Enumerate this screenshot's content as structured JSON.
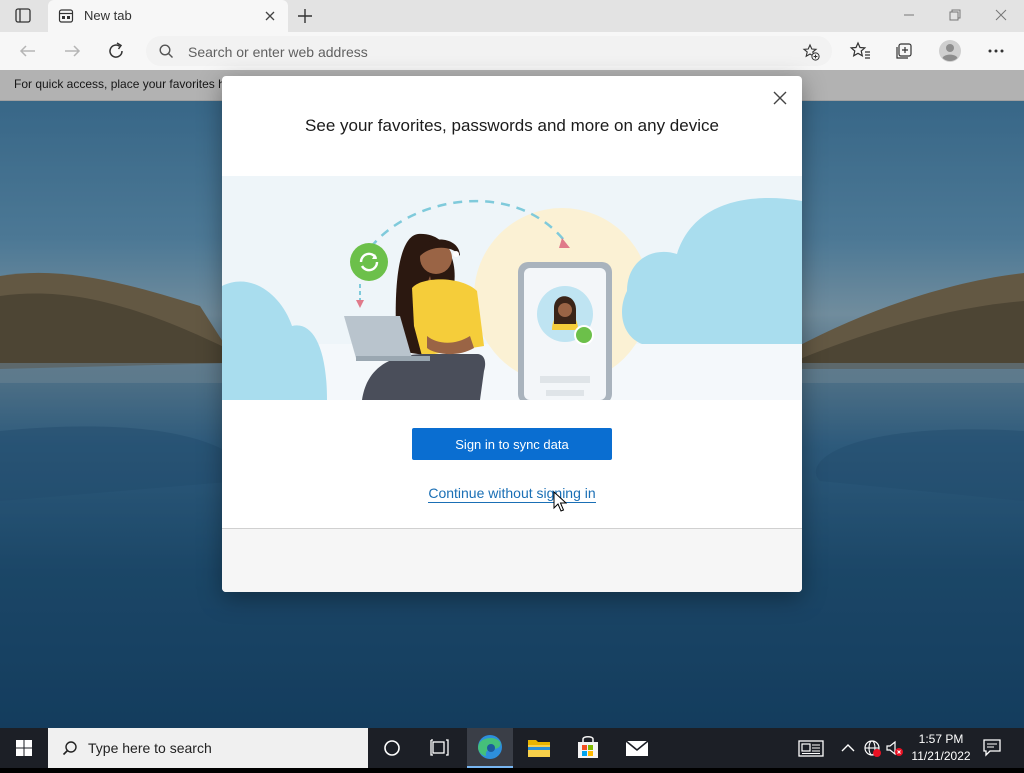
{
  "browser": {
    "tab": {
      "title": "New tab"
    },
    "address_bar": {
      "placeholder": "Search or enter web address"
    },
    "favorites_bar": {
      "message": "For quick access, place your favorites h"
    }
  },
  "dialog": {
    "title": "See your favorites, passwords and more on any device",
    "primary_button": "Sign in to sync data",
    "secondary_link": "Continue without signing in"
  },
  "taskbar": {
    "search_placeholder": "Type here to search",
    "time": "1:57 PM",
    "date": "11/21/2022"
  },
  "colors": {
    "accent": "#0a6ed1",
    "link": "#1a6fb5",
    "taskbar": "#1c1f26"
  },
  "icons": [
    "tab-actions-icon",
    "newtab-page-icon",
    "close-icon",
    "plus-icon",
    "minimize-icon",
    "restore-icon",
    "back-icon",
    "forward-icon",
    "refresh-icon",
    "search-icon",
    "favorite-add-icon",
    "favorites-icon",
    "collections-icon",
    "profile-icon",
    "more-icon",
    "windows-logo-icon",
    "cortana-icon",
    "task-view-icon",
    "edge-icon",
    "file-explorer-icon",
    "store-icon",
    "mail-icon",
    "news-icon",
    "chevron-up-icon",
    "network-icon",
    "volume-muted-icon",
    "notification-icon"
  ]
}
